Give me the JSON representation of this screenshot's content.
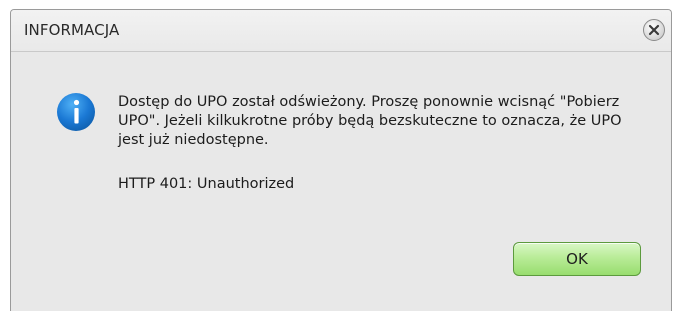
{
  "dialog": {
    "title": "INFORMACJA",
    "message": "Dostęp do UPO został odświeżony. Proszę ponownie wcisnąć \"Pobierz UPO\". Jeżeli kilkukrotne próby będą bezskuteczne to oznacza, że UPO jest już niedostępne.",
    "status": "HTTP 401: Unauthorized",
    "ok_label": "OK",
    "icons": {
      "close": "close-icon",
      "info": "info-icon"
    },
    "colors": {
      "info_icon": "#1a78d4",
      "ok_button": "#a8e486"
    }
  }
}
